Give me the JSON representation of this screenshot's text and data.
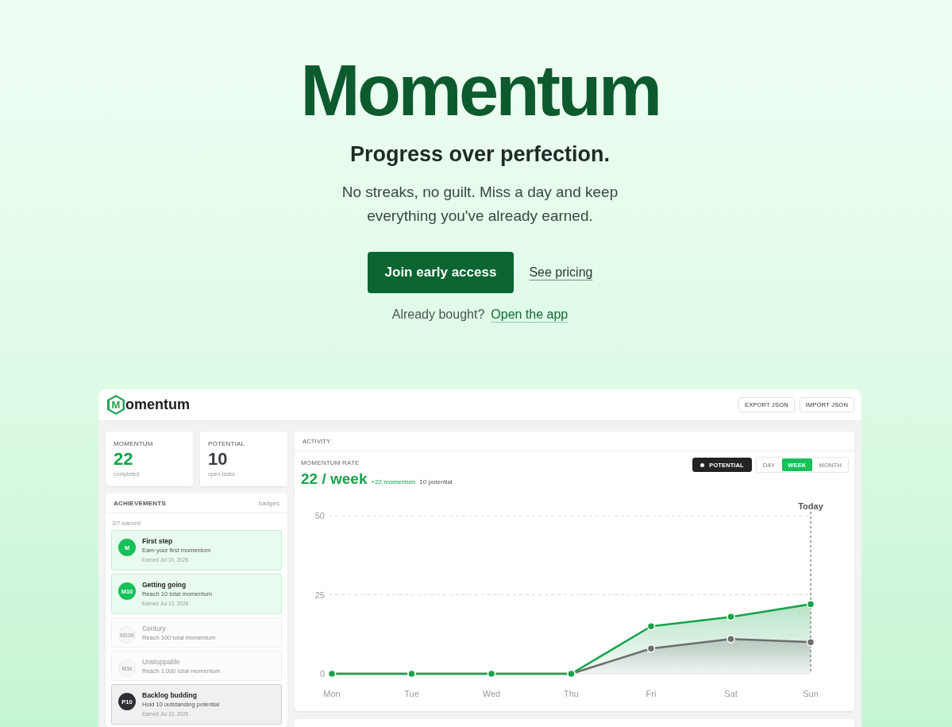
{
  "hero": {
    "title": "Momentum",
    "tagline": "Progress over perfection.",
    "description": "No streaks, no guilt. Miss a day and keep everything you've already earned.",
    "primary_button": "Join early access",
    "secondary_link": "See pricing",
    "signin_prompt": "Already bought?",
    "signin_link": "Open the app"
  },
  "app": {
    "logo": {
      "mark": "M",
      "wordmark": "omentum"
    },
    "header_buttons": [
      "EXPORT JSON",
      "IMPORT JSON"
    ],
    "stats": [
      {
        "label": "MOMENTUM",
        "value": "22",
        "caption": "completed",
        "kind": "momentum"
      },
      {
        "label": "POTENTIAL",
        "value": "10",
        "caption": "open tasks",
        "kind": "potential"
      }
    ],
    "achievements": {
      "title": "ACHIEVEMENTS",
      "note": "badges",
      "summary": "3/7 earned",
      "items": [
        {
          "badge": "M",
          "title": "First step",
          "description": "Earn your first momentum",
          "date": "Earned Jul 10, 2026",
          "earned": true,
          "kind": "momentum"
        },
        {
          "badge": "M10",
          "title": "Getting going",
          "description": "Reach 10 total momentum",
          "date": "Earned Jul 10, 2026",
          "earned": true,
          "kind": "momentum"
        },
        {
          "badge": "M100",
          "title": "Century",
          "description": "Reach 100 total momentum",
          "earned": false,
          "kind": "momentum"
        },
        {
          "badge": "M1k",
          "title": "Unstoppable",
          "description": "Reach 1,000 total momentum",
          "earned": false,
          "kind": "momentum"
        },
        {
          "badge": "P10",
          "title": "Backlog budding",
          "description": "Hold 10 outstanding potential",
          "date": "Earned Jul 10, 2026",
          "earned": true,
          "kind": "potential"
        }
      ]
    },
    "activity": {
      "title": "ACTIVITY",
      "rate_label": "MOMENTUM RATE",
      "rate": "22 / week",
      "momentum_delta": "+22 momentum",
      "potential_note": "10 potential",
      "potential_toggle": {
        "label": "POTENTIAL",
        "on": true
      },
      "ranges": [
        {
          "label": "DAY",
          "selected": false
        },
        {
          "label": "WEEK",
          "selected": true
        },
        {
          "label": "MONTH",
          "selected": false
        }
      ],
      "chart_data": {
        "type": "area",
        "categories": [
          "Mon",
          "Tue",
          "Wed",
          "Thu",
          "Fri",
          "Sat",
          "Sun"
        ],
        "series": [
          {
            "color": "#16a34a",
            "values": [
              0,
              0,
              0,
              0,
              15,
              18,
              22
            ]
          },
          {
            "color": "#6b6e6c",
            "values": [
              0,
              0,
              0,
              0,
              8,
              11,
              10
            ]
          }
        ],
        "ylim": [
          0,
          50
        ],
        "yticks": [
          0,
          25,
          50
        ],
        "annotations": [
          "Today"
        ]
      }
    }
  }
}
